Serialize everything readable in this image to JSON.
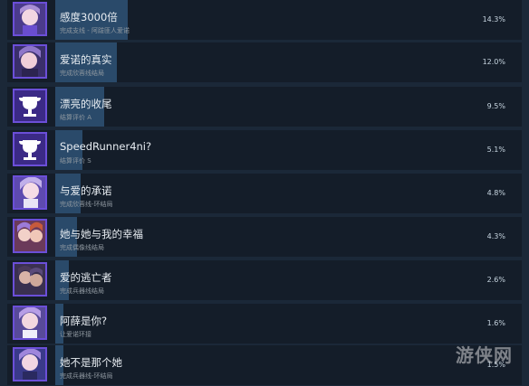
{
  "achievements": [
    {
      "title": "感度3000倍",
      "desc": "完成支线 - 阿跋匪人爱诺",
      "pct": "14.3%",
      "icon": "anime-portrait-icon",
      "fill": 14.3
    },
    {
      "title": "爱诺的真实",
      "desc": "完成欣蓉线结局",
      "pct": "12.0%",
      "icon": "anime-portrait-icon",
      "fill": 12.0
    },
    {
      "title": "漂亮的收尾",
      "desc": "结算评价 A",
      "pct": "9.5%",
      "icon": "trophy-icon",
      "fill": 9.5
    },
    {
      "title": "SpeedRunner4ni?",
      "desc": "结算评价 S",
      "pct": "5.1%",
      "icon": "trophy-icon",
      "fill": 5.1
    },
    {
      "title": "与爱的承诺",
      "desc": "完成欣蓉线-环结局",
      "pct": "4.8%",
      "icon": "anime-portrait-icon",
      "fill": 4.8
    },
    {
      "title": "她与她与我的幸福",
      "desc": "完成偶像线结局",
      "pct": "4.3%",
      "icon": "anime-portrait-icon",
      "fill": 4.3
    },
    {
      "title": "爱的逃亡者",
      "desc": "完成兵器线结局",
      "pct": "2.6%",
      "icon": "anime-portrait-icon",
      "fill": 2.6
    },
    {
      "title": "阿薛是你?",
      "desc": "让爱诺环接",
      "pct": "1.6%",
      "icon": "anime-portrait-icon",
      "fill": 1.6
    },
    {
      "title": "她不是那个她",
      "desc": "完成兵器线-环结局",
      "pct": "1.5%",
      "icon": "anime-portrait-icon",
      "fill": 1.5
    }
  ],
  "watermark": "游侠网"
}
